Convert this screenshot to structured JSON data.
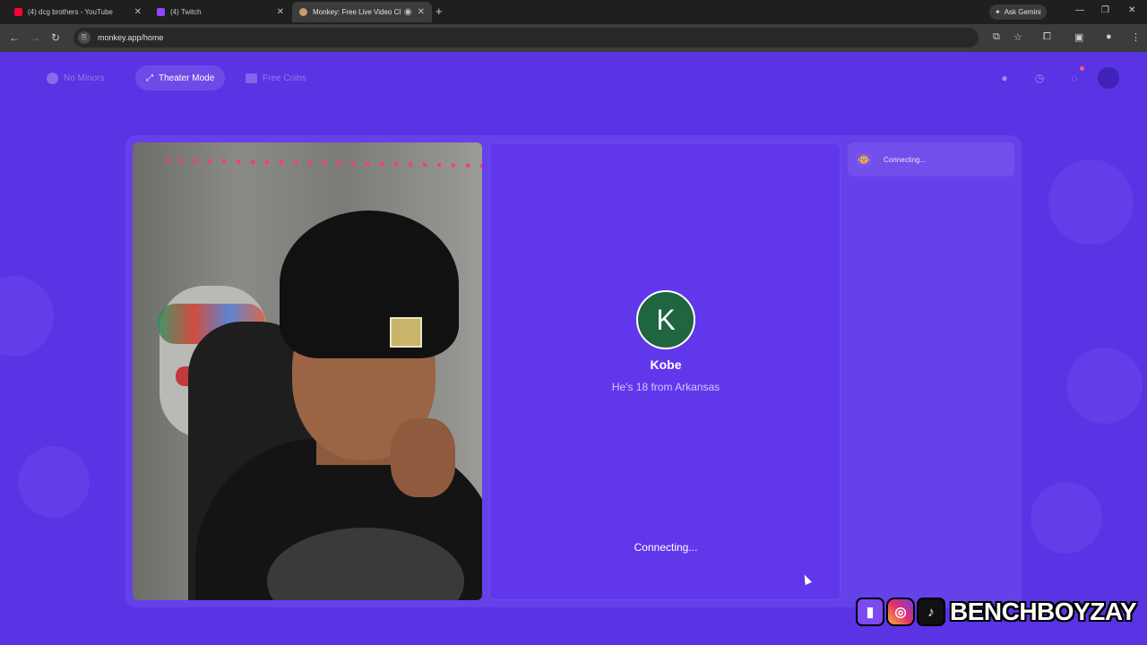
{
  "browser": {
    "tabs": [
      {
        "title": "(4) dcg brothers - YouTube",
        "favicon_color": "#ff0033"
      },
      {
        "title": "(4) Twitch",
        "favicon_color": "#9146ff"
      },
      {
        "title": "Monkey: Free Live Video Ch",
        "favicon_color": "#c99a6b"
      }
    ],
    "new_tab_glyph": "+",
    "gemini_label": "Ask Gemini",
    "url": "monkey.app/home"
  },
  "topnav": {
    "no_minors": "No Minors",
    "theater_mode": "Theater Mode",
    "free_coins": "Free Coins"
  },
  "peer": {
    "avatar_letter": "K",
    "avatar_color": "#1f6540",
    "name": "Kobe",
    "info": "He's 18 from Arkansas",
    "status": "Connecting..."
  },
  "chat": {
    "status": "Connecting..."
  },
  "watermark": {
    "name": "BENCHBOYZAY"
  },
  "colors": {
    "page_bg": "#5a33e4",
    "card_bg": "#6541ea",
    "panel_bg": "#6137ec"
  },
  "icons": [
    "back-icon",
    "forward-icon",
    "reload-icon",
    "star-icon",
    "extensions-icon",
    "clock-icon",
    "chat-icon",
    "monkey-icon",
    "twitch-icon",
    "instagram-icon",
    "tiktok-icon"
  ]
}
